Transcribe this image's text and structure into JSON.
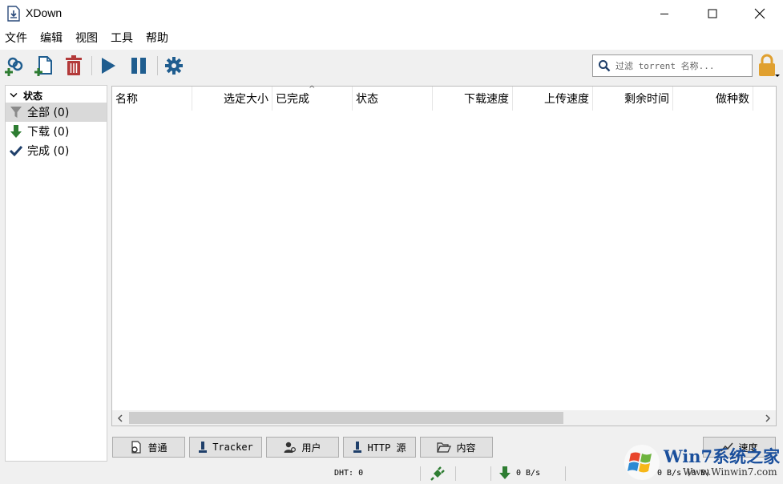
{
  "window": {
    "title": "XDown"
  },
  "menu": [
    "文件",
    "编辑",
    "视图",
    "工具",
    "帮助"
  ],
  "toolbar": {
    "search": {
      "placeholder": "过滤 torrent 名称..."
    }
  },
  "sidebar": {
    "header": "状态",
    "items": [
      {
        "label": "全部 (0)",
        "icon": "filter-icon",
        "selected": true
      },
      {
        "label": "下载 (0)",
        "icon": "download-arrow-icon",
        "selected": false
      },
      {
        "label": "完成 (0)",
        "icon": "checkmark-icon",
        "selected": false
      }
    ]
  },
  "table": {
    "columns": [
      "名称",
      "选定大小",
      "已完成",
      "状态",
      "下载速度",
      "上传速度",
      "剩余时间",
      "做种数"
    ],
    "sorted_column": "已完成",
    "rows": []
  },
  "tabs": [
    "普通",
    "Tracker",
    "用户",
    "HTTP 源",
    "内容",
    "速度"
  ],
  "status": {
    "dht": "DHT: 0",
    "download_speed": "0 B/s",
    "upload_speed": "0 B/s (0 B)"
  },
  "watermark": {
    "brand": "Win7系统之家",
    "url": "Www.Winwin7.com"
  },
  "colors": {
    "green": "#2e7d32",
    "red": "#b33a3a",
    "icon_blue": "#1f5d8f",
    "lock": "#e0a030"
  }
}
